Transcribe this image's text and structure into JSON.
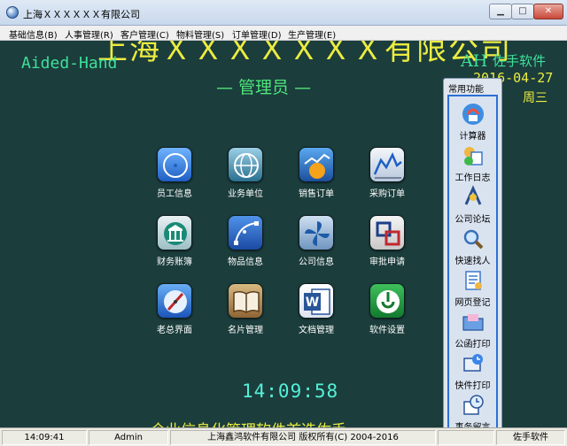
{
  "window": {
    "title": "上海ＸＸＸＸＸＸ有限公司",
    "min_icon": "minimize-icon",
    "max_icon": "maximize-icon",
    "close_icon": "close-icon"
  },
  "menu": [
    "基础信息(B)",
    "人事管理(R)",
    "客户管理(C)",
    "物料管理(S)",
    "订单管理(D)",
    "生产管理(E)"
  ],
  "header": {
    "company": "上海ＸＸＸＸＸＸＸ有限公司",
    "aided_hand": "Aided-Hand",
    "role": "— 管理员 —",
    "brand_ah": "AH",
    "brand_name": "佐手软件",
    "date": "2016-04-27",
    "weekday": "周三"
  },
  "grid": [
    {
      "label": "员工信息",
      "icon": "compass-icon"
    },
    {
      "label": "业务单位",
      "icon": "globe-icon"
    },
    {
      "label": "销售订单",
      "icon": "sales-chart-icon"
    },
    {
      "label": "采购订单",
      "icon": "line-chart-icon"
    },
    {
      "label": "财务账簿",
      "icon": "bank-icon"
    },
    {
      "label": "物品信息",
      "icon": "vector-curve-icon"
    },
    {
      "label": "公司信息",
      "icon": "pinwheel-icon"
    },
    {
      "label": "审批申请",
      "icon": "approval-icon"
    },
    {
      "label": "老总界面",
      "icon": "safari-compass-icon"
    },
    {
      "label": "名片管理",
      "icon": "book-icon"
    },
    {
      "label": "文档管理",
      "icon": "word-document-icon"
    },
    {
      "label": "软件设置",
      "icon": "settings-globe-icon"
    }
  ],
  "clock": "14:09:58",
  "marquee": "企业信息化管理软件首选佐手",
  "quick_panel": {
    "title": "常用功能",
    "items": [
      {
        "label": "计算器",
        "icon": "calculator-icon"
      },
      {
        "label": "工作日志",
        "icon": "work-log-icon"
      },
      {
        "label": "公司论坛",
        "icon": "forum-icon"
      },
      {
        "label": "快速找人",
        "icon": "magnifier-icon"
      },
      {
        "label": "网页登记",
        "icon": "web-register-icon"
      },
      {
        "label": "公函打印",
        "icon": "folder-print-icon"
      },
      {
        "label": "快件打印",
        "icon": "express-print-icon"
      },
      {
        "label": "事务留言",
        "icon": "message-clock-icon"
      }
    ]
  },
  "status": {
    "time": "14:09:41",
    "user": "Admin",
    "copyright": "上海鑫鸿软件有限公司 版权所有(C) 2004-2016",
    "brand": "佐手软件"
  }
}
